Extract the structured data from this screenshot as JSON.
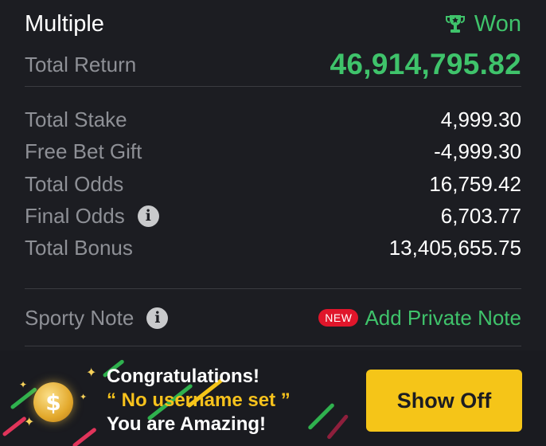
{
  "header": {
    "title": "Multiple",
    "status": "Won",
    "status_icon": "trophy-icon"
  },
  "total_return": {
    "label": "Total Return",
    "value": "46,914,795.82"
  },
  "details": [
    {
      "label": "Total Stake",
      "value": "4,999.30"
    },
    {
      "label": "Free Bet Gift",
      "value": "-4,999.30"
    },
    {
      "label": "Total Odds",
      "value": "16,759.42"
    },
    {
      "label": "Final Odds",
      "value": "6,703.77",
      "info_icon": "i"
    },
    {
      "label": "Total Bonus",
      "value": "13,405,655.75"
    }
  ],
  "note": {
    "label": "Sporty Note",
    "info_icon": "i",
    "badge": "NEW",
    "action": "Add Private Note"
  },
  "banner": {
    "line1": "Congratulations!",
    "line2": "“ No username set ”",
    "line3": "You are Amazing!",
    "coin_symbol": "$",
    "button": "Show Off"
  },
  "colors": {
    "background": "#1c1d22",
    "accent_green": "#3fc36b",
    "muted_text": "#8e9096",
    "badge_red": "#e0162b",
    "button_yellow": "#f5c518"
  }
}
